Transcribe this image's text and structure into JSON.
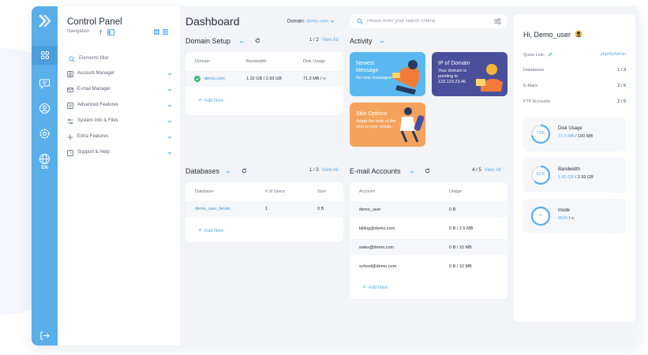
{
  "sidebar": {
    "title": "Control Panel",
    "subtitle": "Navigation",
    "language": "EN",
    "filter_placeholder": "Elements filter",
    "items": [
      {
        "label": "Account Manager"
      },
      {
        "label": "E-mail Manager"
      },
      {
        "label": "Advanced Features"
      },
      {
        "label": "System Info & Files"
      },
      {
        "label": "Extra Features"
      },
      {
        "label": "Support & Help"
      }
    ]
  },
  "header": {
    "title": "Dashboard",
    "domain_label": "Domain:",
    "domain_value": "demo.com",
    "search_placeholder": "Please enter your search criteria"
  },
  "domain_setup": {
    "title": "Domain Setup",
    "pager": "1 / 2",
    "view_all": "View All",
    "columns": [
      "Domain",
      "Bandwidth",
      "Disk Usage"
    ],
    "row": {
      "domain": "demo.com",
      "bandwidth": "1.32 GB / 2.93 GB",
      "disk": "71.3 MB / ∞"
    },
    "add_new": "Add New"
  },
  "activity": {
    "title": "Activity",
    "tiles": [
      {
        "title": "Newest Message",
        "text": "No new messages",
        "color": "#5ab8f0"
      },
      {
        "title": "IP of Domain",
        "text": "Your domain is pointing to 123.123.23.45",
        "color": "#4a4f9c"
      },
      {
        "title": "Skin Options",
        "text": "Adapt the look of the skin to your needs.",
        "color": "#f5a35c"
      }
    ]
  },
  "databases": {
    "title": "Databases",
    "pager": "1 / 3",
    "view_all": "View All",
    "columns": [
      "Database",
      "# of Users",
      "Size"
    ],
    "row": {
      "name": "demo_user_forum",
      "users": "1",
      "size": "0 B"
    },
    "add_new": "Add New"
  },
  "email_accounts": {
    "title": "E-mail Accounts",
    "pager": "4 / 5",
    "view_all": "View All",
    "columns": [
      "Account",
      "Usage"
    ],
    "rows": [
      {
        "account": "demo_user",
        "usage": "0 B"
      },
      {
        "account": "billing@demo.com",
        "usage": "0 B / 2.5 MB"
      },
      {
        "account": "sales@demo.com",
        "usage": "0 B / 10 MB"
      },
      {
        "account": "school@demo.com",
        "usage": "0 B / 10 MB"
      }
    ],
    "add_new": "Add New"
  },
  "user_panel": {
    "greeting": "Hi, Demo_user",
    "quick_link_label": "Quick Link:",
    "quick_link_value": "phpMyAdmin",
    "stats": [
      {
        "label": "Databases",
        "value": "1 / 3"
      },
      {
        "label": "E-Mails",
        "value": "2 / 5"
      },
      {
        "label": "FTP Accounts",
        "value": "2 / 5"
      }
    ],
    "usage": [
      {
        "label": "Disk Usage",
        "ring_text": "72%",
        "fraction": 0.72,
        "used": "72.3 MB",
        "total": "100 MB"
      },
      {
        "label": "Bandwidth",
        "ring_text": "62%",
        "fraction": 0.62,
        "used": "1.83 GB",
        "total": "2.93 GB"
      },
      {
        "label": "Inode",
        "ring_text": "∞",
        "fraction": 1.0,
        "used": "8565",
        "total": "∞"
      }
    ]
  },
  "colors": {
    "accent": "#5aaeea",
    "rail": "#5aaeea",
    "frame_bg": "#f3f4f7",
    "success": "#3db46d"
  }
}
